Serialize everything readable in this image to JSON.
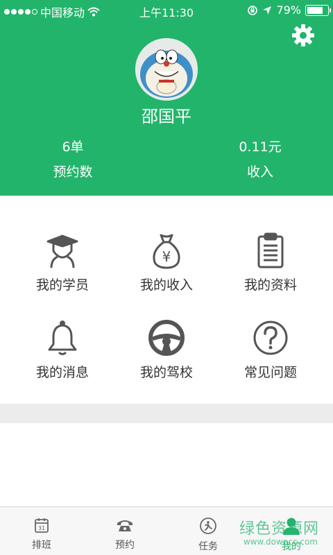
{
  "status_bar": {
    "carrier": "中国移动",
    "time": "上午11:30",
    "battery": "79%",
    "battery_level": 0.79
  },
  "profile": {
    "name": "邵国平",
    "orders_value": "6单",
    "orders_label": "预约数",
    "income_value": "0.11元",
    "income_label": "收入"
  },
  "menu": [
    {
      "label": "我的学员",
      "icon": "graduate-icon"
    },
    {
      "label": "我的收入",
      "icon": "money-bag-icon"
    },
    {
      "label": "我的资料",
      "icon": "clipboard-icon"
    },
    {
      "label": "我的消息",
      "icon": "bell-icon"
    },
    {
      "label": "我的驾校",
      "icon": "steering-wheel-icon"
    },
    {
      "label": "常见问题",
      "icon": "question-icon"
    }
  ],
  "tabs": [
    {
      "label": "排班",
      "icon": "calendar-icon",
      "calendar_day": "31"
    },
    {
      "label": "预约",
      "icon": "phone-icon"
    },
    {
      "label": "任务",
      "icon": "task-icon"
    },
    {
      "label": "我的",
      "icon": "person-icon",
      "active": true
    }
  ],
  "watermark": {
    "text": "绿色资源网",
    "url": "www.downcc.com"
  },
  "colors": {
    "accent": "#22b46b",
    "menu_icon": "#555555"
  }
}
